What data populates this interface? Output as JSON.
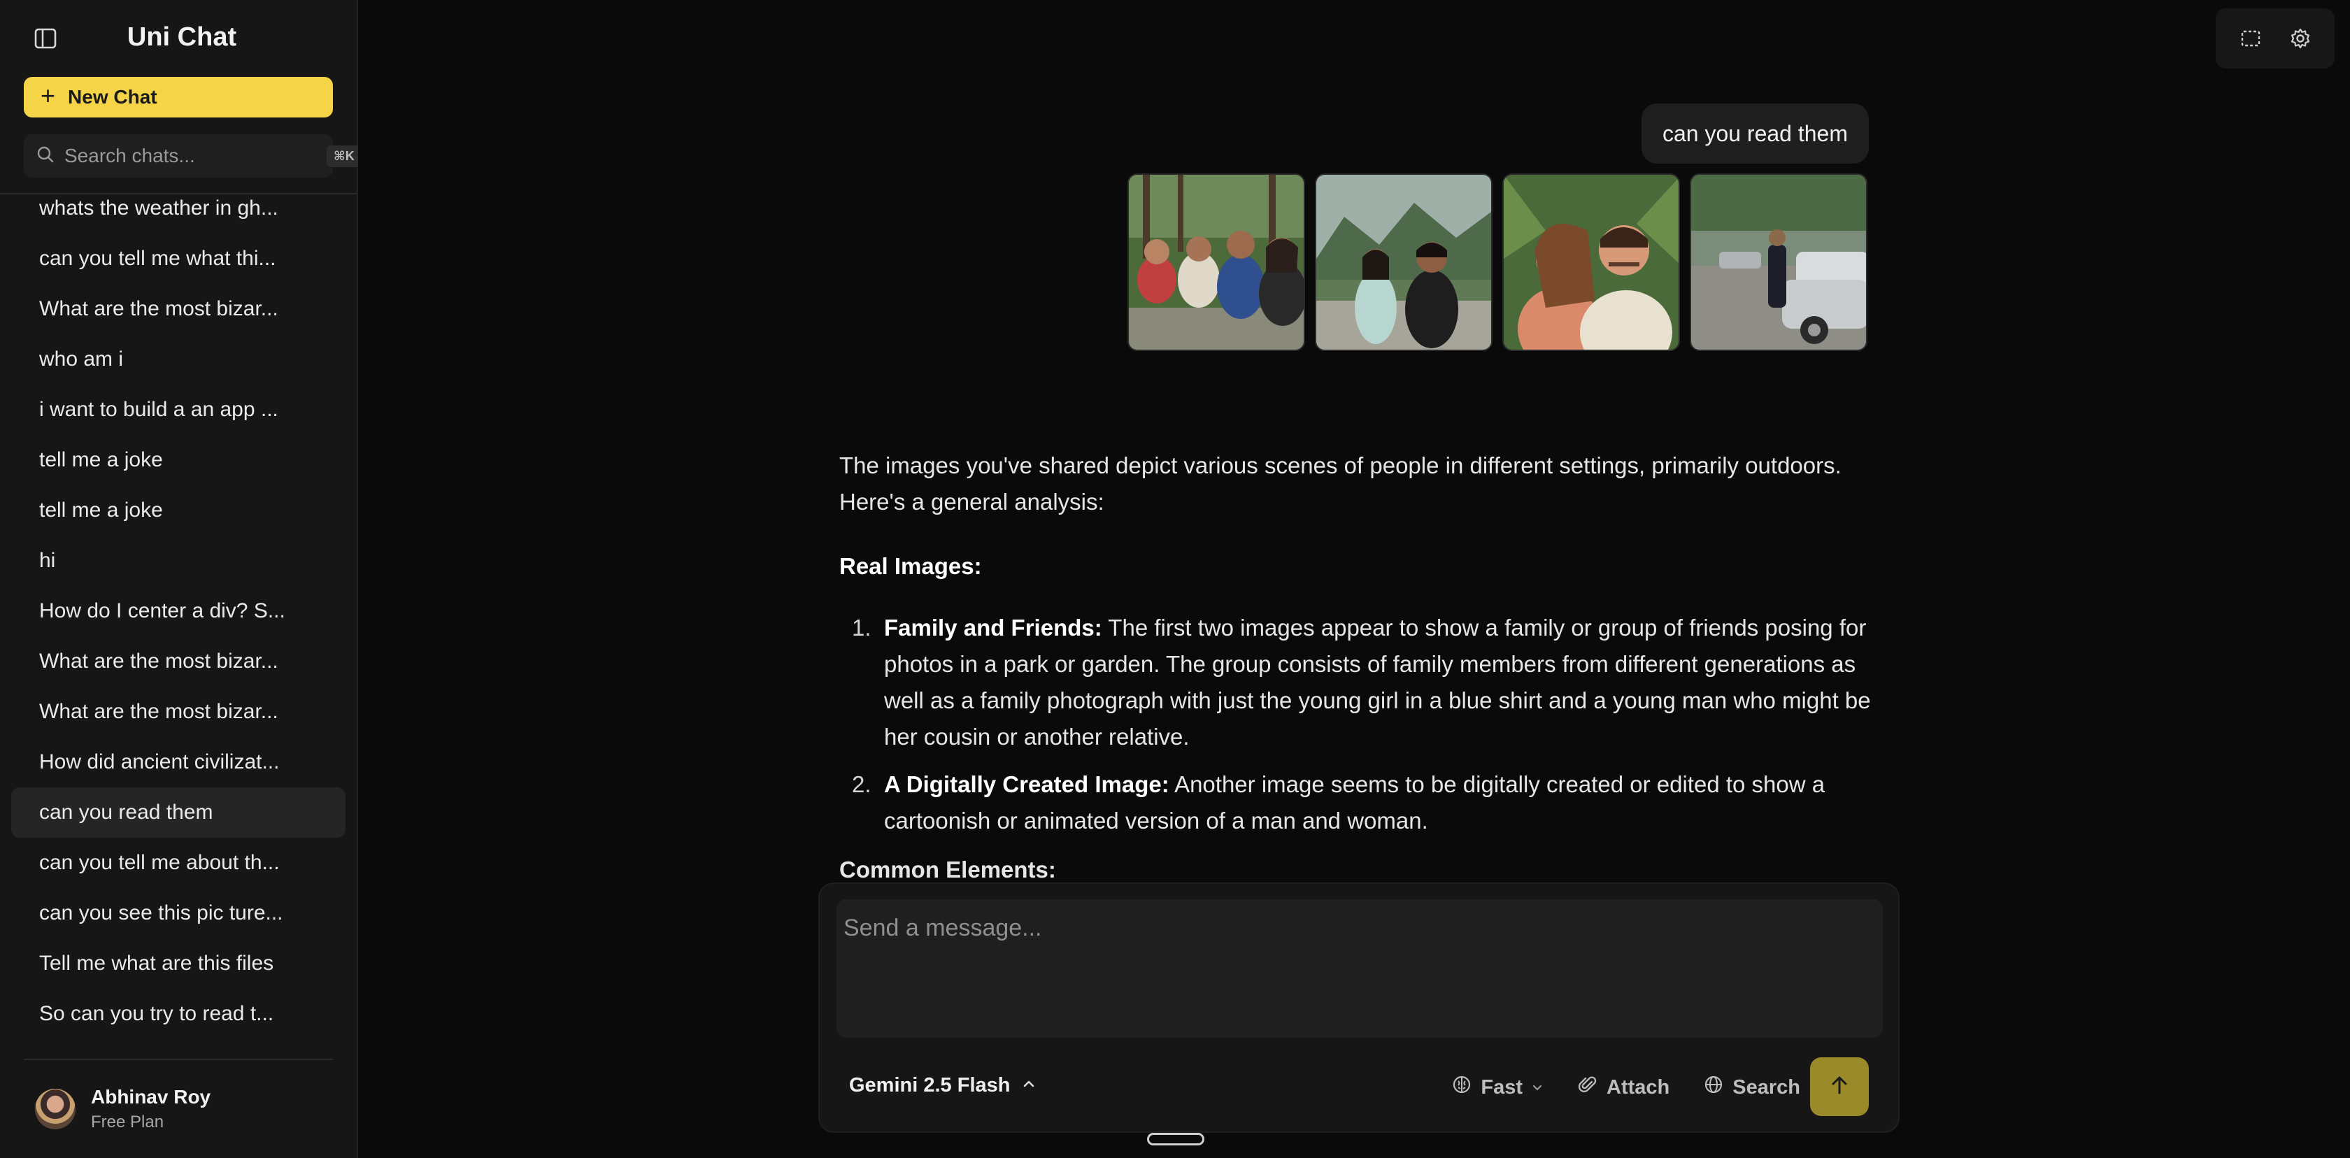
{
  "app": {
    "title": "Uni Chat"
  },
  "sidebar": {
    "new_chat_label": "New Chat",
    "search": {
      "placeholder": "Search chats...",
      "shortcut": "⌘K"
    },
    "chats": [
      "whats the weather in gh...",
      "can you tell me what thi...",
      "What are the most bizar...",
      "who am i",
      "i want to build a an app ...",
      "tell me a joke",
      "tell me a joke",
      "hi",
      "How do I center a div? S...",
      "What are the most bizar...",
      "What are the most bizar...",
      "How did ancient civilizat...",
      "can you read them",
      "can you tell me about th...",
      "can you see this pic ture...",
      "Tell me what are this files",
      "So can you try to read t..."
    ],
    "active_index": 12,
    "profile": {
      "name": "Abhinav Roy",
      "plan": "Free Plan"
    }
  },
  "conversation": {
    "user_message": "can you read them",
    "attachments": [
      "photo-1",
      "photo-2",
      "photo-3",
      "photo-4"
    ],
    "answer": {
      "intro": "The images you've shared depict various scenes of people in different settings, primarily outdoors. Here's a general analysis:",
      "section_heading": "Real Images:",
      "items": [
        {
          "num": "1.",
          "title": "Family and Friends:",
          "text": " The first two images appear to show a family or group of friends posing for photos in a park or garden. The group consists of family members from different generations as well as a family photograph with just the young girl in a blue shirt and a young man who might be her cousin or another relative."
        },
        {
          "num": "2.",
          "title": "A Digitally Created Image:",
          "text": " Another image seems to be digitally created or edited to show a cartoonish or animated version of a man and woman."
        }
      ],
      "next_heading_peek": "Common Elements:"
    }
  },
  "composer": {
    "placeholder": "Send a message...",
    "model": "Gemini 2.5 Flash",
    "mode": "Fast",
    "attach_label": "Attach",
    "search_label": "Search"
  },
  "colors": {
    "accent": "#f5d547",
    "send_button": "#9a8a2a",
    "sidebar_bg": "#161616",
    "main_bg": "#0a0a0a"
  }
}
